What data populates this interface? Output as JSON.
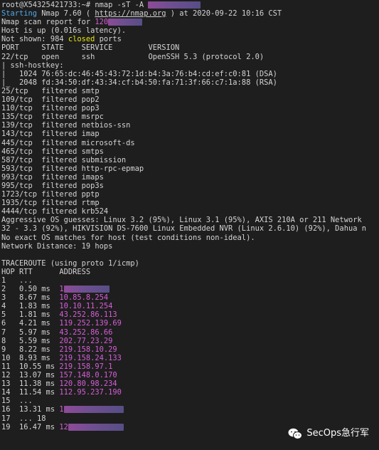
{
  "terminal": {
    "prompt_line": {
      "prompt": "root@X54325421733:~# ",
      "command": "nmap -sT -A "
    },
    "starting_line": {
      "starting": "Starting",
      "nmap_text": " Nmap 7.60 ( ",
      "url": "https://nmap.org",
      "rest": " ) at 2020-09-22 10:16 CST"
    },
    "scan_report": {
      "text": "Nmap scan report for ",
      "ip_prefix": "120"
    },
    "host_up": "Host is up (0.016s latency).",
    "not_shown": {
      "prefix": "Not shown: 984 ",
      "closed": "closed",
      "suffix": " ports"
    },
    "port_header": "PORT     STATE    SERVICE        VERSION",
    "port_22": "22/tcp   open     ssh            OpenSSH 5.3 (protocol 2.0)",
    "hostkey_lines": [
      "| ssh-hostkey:",
      "|   1024 76:65:dc:46:45:43:72:1d:b4:3a:76:b4:cd:ef:c0:81 (DSA)",
      "|_  2048 fd:34:50:df:43:34:cf:b4:50:fa:71:3f:66:c7:1a:88 (RSA)"
    ],
    "filtered_ports": [
      "25/tcp   filtered smtp",
      "109/tcp  filtered pop2",
      "110/tcp  filtered pop3",
      "135/tcp  filtered msrpc",
      "139/tcp  filtered netbios-ssn",
      "143/tcp  filtered imap",
      "445/tcp  filtered microsoft-ds",
      "465/tcp  filtered smtps",
      "587/tcp  filtered submission",
      "593/tcp  filtered http-rpc-epmap",
      "993/tcp  filtered imaps",
      "995/tcp  filtered pop3s",
      "1723/tcp filtered pptp",
      "1935/tcp filtered rtmp",
      "4444/tcp filtered krb524"
    ],
    "os_lines": [
      "Aggressive OS guesses: Linux 3.2 (95%), Linux 3.1 (95%), AXIS 210A or 211 Network",
      "32 - 3.3 (92%), HIKVISION DS-7600 Linux Embedded NVR (Linux 2.6.10) (92%), Dahua n",
      "No exact OS matches for host (test conditions non-ideal).",
      "Network Distance: 19 hops"
    ],
    "traceroute_header": "TRACEROUTE (using proto 1/icmp)",
    "hop_header": "HOP RTT      ADDRESS",
    "hops": [
      {
        "prefix": "1   ...",
        "address": ""
      },
      {
        "prefix": "2   0.50 ms  ",
        "address": "1"
      },
      {
        "prefix": "3   8.67 ms  ",
        "address": "10.85.8.254"
      },
      {
        "prefix": "4   1.83 ms  ",
        "address": "10.10.11.254"
      },
      {
        "prefix": "5   1.81 ms  ",
        "address": "43.252.86.113"
      },
      {
        "prefix": "6   4.21 ms  ",
        "address": "119.252.139.69"
      },
      {
        "prefix": "7   5.97 ms  ",
        "address": "43.252.86.66"
      },
      {
        "prefix": "8   5.59 ms  ",
        "address": "202.77.23.29"
      },
      {
        "prefix": "9   8.22 ms  ",
        "address": "219.158.10.29"
      },
      {
        "prefix": "10  8.93 ms  ",
        "address": "219.158.24.133"
      },
      {
        "prefix": "11  10.55 ms ",
        "address": "219.158.97.1"
      },
      {
        "prefix": "12  13.07 ms ",
        "address": "157.148.0.170"
      },
      {
        "prefix": "13  11.38 ms ",
        "address": "120.80.98.234"
      },
      {
        "prefix": "14  11.54 ms ",
        "address": "112.95.237.190"
      },
      {
        "prefix": "15  ...",
        "address": ""
      },
      {
        "prefix": "16  13.31 ms ",
        "address": "1"
      },
      {
        "prefix": "17  ... 18",
        "address": ""
      },
      {
        "prefix": "19  16.47 ms ",
        "address": "12"
      }
    ],
    "watermark": "SecOps急行军"
  },
  "colors": {
    "background": "#1e1e1e",
    "foreground": "#d4d4d4",
    "starting_blue": "#4fa9e8",
    "address_magenta": "#d65ed8",
    "closed_yellow": "#e5e510"
  }
}
